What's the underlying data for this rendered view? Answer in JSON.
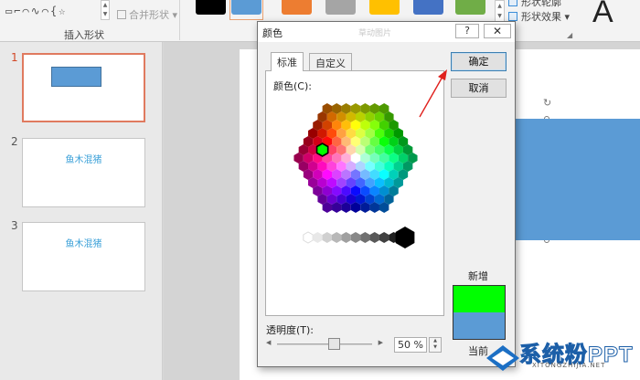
{
  "ribbon": {
    "merge_shapes": "合并形状",
    "insert_shapes_group": "插入形状",
    "shape_outline": "形状轮廓",
    "shape_effects": "形状效果",
    "wordart_letter": "A",
    "swatch_colors": [
      "#000000",
      "#5b9bd5",
      "#ed7d31",
      "#a5a5a5",
      "#ffc000",
      "#4472c4",
      "#70ad47"
    ]
  },
  "thumbnails": [
    {
      "number": "1",
      "text": ""
    },
    {
      "number": "2",
      "text": "鱼木混猪"
    },
    {
      "number": "3",
      "text": "鱼木混猪"
    }
  ],
  "dialog": {
    "title": "颜色",
    "faint_title": "草动图片",
    "help": "?",
    "close": "✕",
    "tabs": [
      "标准",
      "自定义"
    ],
    "colors_label": "颜色(C):",
    "ok": "确定",
    "cancel": "取消",
    "new_label": "新增",
    "current_label": "当前",
    "transparency_label": "透明度(T):",
    "transparency_value": "50 %",
    "new_color": "#00ff00",
    "current_color": "#5b9bd5"
  },
  "watermark": {
    "main": "系统粉PPT",
    "sub": "XITONGZHIJIA.NET"
  },
  "annotation_color": "#e0201c"
}
